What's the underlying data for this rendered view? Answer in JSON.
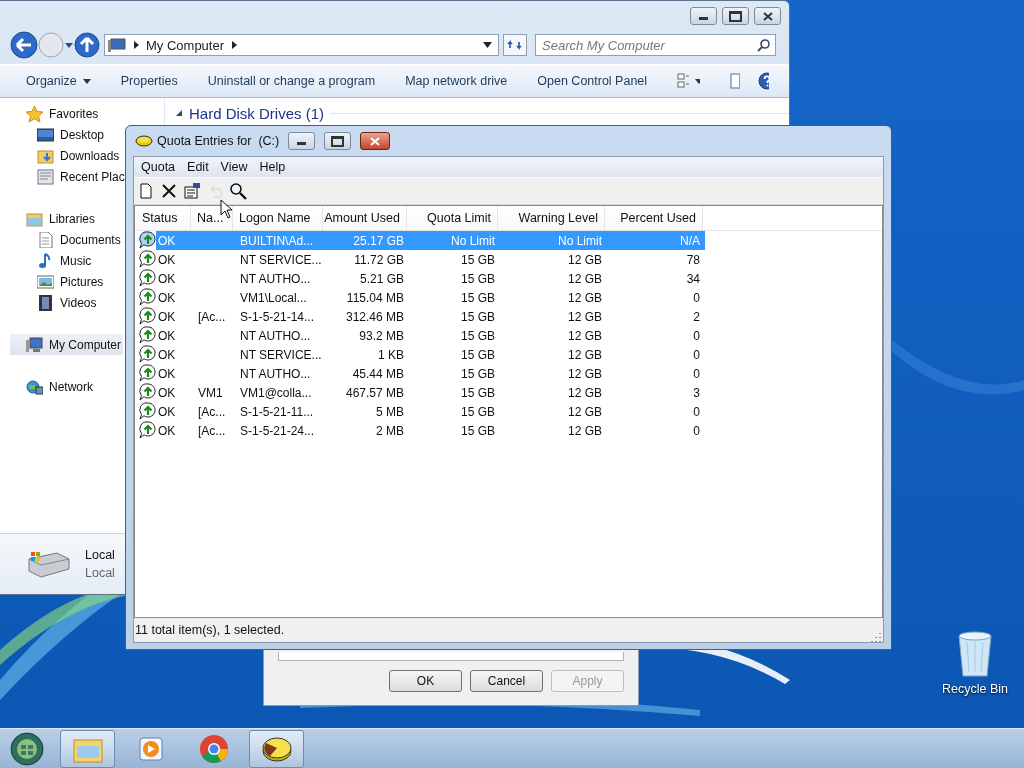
{
  "explorer": {
    "address": "My Computer",
    "search_placeholder": "Search My Computer",
    "commands": [
      {
        "label": "Organize",
        "dropdown": true
      },
      {
        "label": "Properties",
        "dropdown": false
      },
      {
        "label": "Uninstall or change a program",
        "dropdown": false
      },
      {
        "label": "Map network drive",
        "dropdown": false
      },
      {
        "label": "Open Control Panel",
        "dropdown": false
      }
    ],
    "sidebar": [
      {
        "label": "Favorites",
        "kind": "star",
        "selected": false,
        "children": [
          {
            "label": "Desktop",
            "kind": "desktop",
            "selected": false
          },
          {
            "label": "Downloads",
            "kind": "downloads",
            "selected": false
          },
          {
            "label": "Recent Plac",
            "kind": "recent",
            "selected": false
          }
        ]
      },
      {
        "label": "Libraries",
        "kind": "library",
        "selected": false,
        "children": [
          {
            "label": "Documents",
            "kind": "document",
            "selected": false
          },
          {
            "label": "Music",
            "kind": "music",
            "selected": false
          },
          {
            "label": "Pictures",
            "kind": "pictures",
            "selected": false
          },
          {
            "label": "Videos",
            "kind": "videos",
            "selected": false
          }
        ]
      },
      {
        "label": "My Computer",
        "kind": "computer",
        "selected": true
      },
      {
        "label": "Network",
        "kind": "network",
        "selected": false
      }
    ],
    "section": "Hard Disk Drives (1)",
    "drive": {
      "name": "Local",
      "detail": "Local"
    }
  },
  "properties_dialog": {
    "buttons": [
      {
        "label": "OK",
        "disabled": false
      },
      {
        "label": "Cancel",
        "disabled": false
      },
      {
        "label": "Apply",
        "disabled": true
      }
    ]
  },
  "quota_window": {
    "title": "Quota Entries for  (C:)",
    "menu": [
      "Quota",
      "Edit",
      "View",
      "Help"
    ],
    "tools": [
      {
        "kind": "new",
        "disabled": false
      },
      {
        "kind": "delete",
        "disabled": false
      },
      {
        "kind": "properties",
        "disabled": false
      },
      {
        "kind": "undo",
        "disabled": true
      },
      {
        "kind": "find",
        "disabled": false
      }
    ],
    "columns": [
      "Status",
      "Na...",
      "Logon Name",
      "Amount Used",
      "Quota Limit",
      "Warning Level",
      "Percent Used"
    ],
    "rows": [
      {
        "selected": true,
        "cells": [
          "OK",
          "",
          "BUILTIN\\Ad...",
          "25.17 GB",
          "No Limit",
          "No Limit",
          "N/A"
        ]
      },
      {
        "selected": false,
        "cells": [
          "OK",
          "",
          "NT SERVICE...",
          "11.72 GB",
          "15 GB",
          "12 GB",
          "78"
        ]
      },
      {
        "selected": false,
        "cells": [
          "OK",
          "",
          "NT AUTHO...",
          "5.21 GB",
          "15 GB",
          "12 GB",
          "34"
        ]
      },
      {
        "selected": false,
        "cells": [
          "OK",
          "",
          "VM1\\Local...",
          "115.04 MB",
          "15 GB",
          "12 GB",
          "0"
        ]
      },
      {
        "selected": false,
        "cells": [
          "OK",
          "[Ac...",
          "S-1-5-21-14...",
          "312.46 MB",
          "15 GB",
          "12 GB",
          "2"
        ]
      },
      {
        "selected": false,
        "cells": [
          "OK",
          "",
          "NT AUTHO...",
          "93.2 MB",
          "15 GB",
          "12 GB",
          "0"
        ]
      },
      {
        "selected": false,
        "cells": [
          "OK",
          "",
          "NT SERVICE...",
          "1 KB",
          "15 GB",
          "12 GB",
          "0"
        ]
      },
      {
        "selected": false,
        "cells": [
          "OK",
          "",
          "NT AUTHO...",
          "45.44 MB",
          "15 GB",
          "12 GB",
          "0"
        ]
      },
      {
        "selected": false,
        "cells": [
          "OK",
          "VM1",
          "VM1@colla...",
          "467.57 MB",
          "15 GB",
          "12 GB",
          "3"
        ]
      },
      {
        "selected": false,
        "cells": [
          "OK",
          "[Ac...",
          "S-1-5-21-11...",
          "5 MB",
          "15 GB",
          "12 GB",
          "0"
        ]
      },
      {
        "selected": false,
        "cells": [
          "OK",
          "[Ac...",
          "S-1-5-21-24...",
          "2 MB",
          "15 GB",
          "12 GB",
          "0"
        ]
      }
    ],
    "status_bar": "11 total item(s), 1 selected."
  },
  "desktop": {
    "icons": [
      {
        "label": "Recycle Bin"
      }
    ]
  },
  "taskbar": {
    "items": [
      {
        "kind": "explorer",
        "running": true
      },
      {
        "kind": "media",
        "running": false
      },
      {
        "kind": "browser",
        "running": false
      },
      {
        "kind": "quota",
        "running": true
      }
    ]
  }
}
